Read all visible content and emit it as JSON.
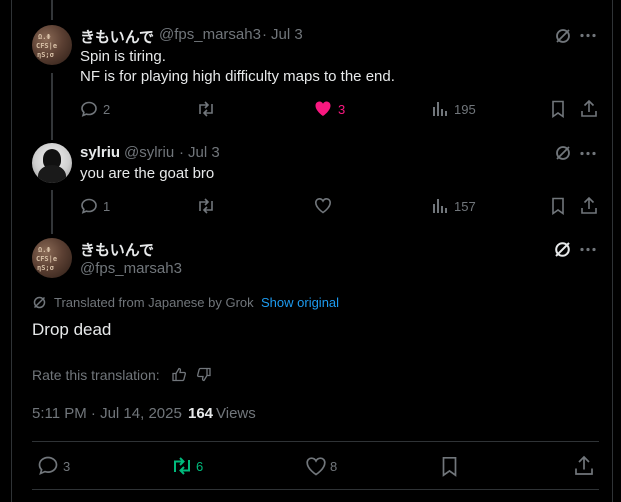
{
  "colors": {
    "like_active": "#f91880",
    "retweet_active": "#00ba7c",
    "link": "#1d9bf0",
    "muted": "#71767b"
  },
  "reply1": {
    "display_name": "きもいんで",
    "handle": "@fps_marsah3",
    "date": "Jul 3",
    "text_line1": "Spin is tiring.",
    "text_line2": "NF is for playing high difficulty maps to the end.",
    "replies": "2",
    "likes": "3",
    "views": "195"
  },
  "reply2": {
    "display_name": "sylriu",
    "handle": "@sylriu",
    "date": "Jul 3",
    "text": "you are the goat bro",
    "replies": "1",
    "views": "157"
  },
  "main": {
    "display_name": "きもいんで",
    "handle": "@fps_marsah3",
    "translated_label": "Translated from Japanese by Grok",
    "show_original": "Show original",
    "text": "Drop dead",
    "rate_label": "Rate this translation:",
    "timestamp": "5:11 PM · Jul 14, 2025",
    "view_count": "164",
    "views_label": "Views",
    "replies": "3",
    "reposts": "6",
    "likes": "8"
  },
  "separator": "·"
}
